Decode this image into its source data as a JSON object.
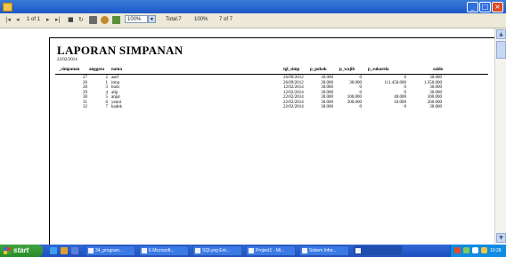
{
  "toolbar": {
    "page_label": "1 of 1",
    "zoom_value": "100%",
    "total_label": "Total:7",
    "percent_label": "100%",
    "count_label": "7 of 7"
  },
  "report": {
    "title": "LAPORAN SIMPANAN",
    "date": "22/02/2014",
    "columns": [
      "_simpanan",
      "anggota",
      "nama",
      "tgl_simp",
      "p_pokok",
      "p_wajib",
      "p_sukarela",
      "saldo"
    ],
    "rows": [
      [
        "27",
        "2",
        "asef",
        "26/09/2012",
        "30.000",
        "0",
        "0",
        "30.000"
      ],
      [
        "26",
        "1",
        "irma",
        "26/09/2012",
        "30.000",
        "30.000",
        "111.450.000",
        "1.350.000"
      ],
      [
        "28",
        "3",
        "budi",
        "12/02/2014",
        "30.000",
        "0",
        "0",
        "30.000"
      ],
      [
        "29",
        "4",
        "alip",
        "12/02/2014",
        "30.000",
        "0",
        "0",
        "30.000"
      ],
      [
        "30",
        "5",
        "anjar",
        "22/02/2014",
        "30.000",
        "100.000",
        "40.000",
        "100.000"
      ],
      [
        "31",
        "6",
        "yenni",
        "22/02/2014",
        "30.000",
        "200.000",
        "10.000",
        "260.000"
      ],
      [
        "32",
        "7",
        "kadek",
        "22/02/2014",
        "30.000",
        "0",
        "0",
        "30.000"
      ]
    ]
  },
  "taskbar": {
    "start_label": "start",
    "tasks": [
      "34_program...",
      "6 Microsoft...",
      "SQLyog Ent...",
      "Project1 - Mi...",
      "Sistem Infor...",
      ""
    ],
    "clock": "10:28"
  },
  "colors": {
    "titlebar": "#1c58c9",
    "taskbar": "#1d4fbf",
    "start": "#2a8a2a",
    "toolbar_bg": "#ece9d8"
  }
}
